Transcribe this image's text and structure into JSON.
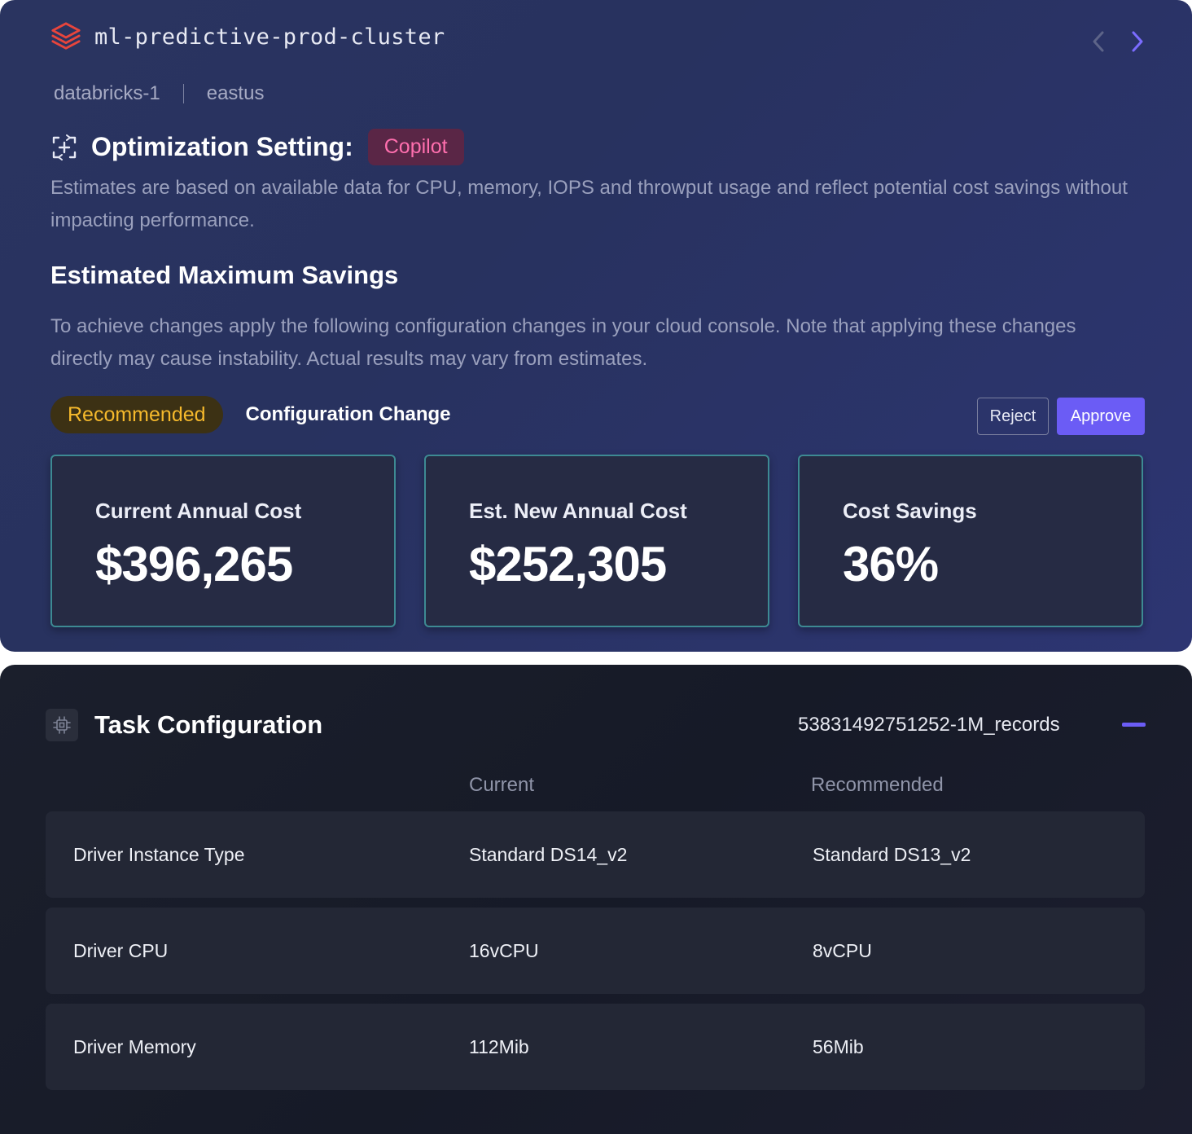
{
  "header": {
    "cluster_name": "ml-predictive-prod-cluster",
    "workspace": "databricks-1",
    "region": "eastus",
    "logo_icon": "databricks-stack-icon",
    "nav": {
      "prev_icon": "chevron-left-icon",
      "next_icon": "chevron-right-icon"
    }
  },
  "optimization": {
    "title": "Optimization Setting:",
    "badge": "Copilot",
    "icon": "optimize-icon",
    "description": "Estimates are based on available data for CPU, memory, IOPS and throwput usage and reflect potential cost savings without impacting performance."
  },
  "savings": {
    "title": "Estimated Maximum Savings",
    "description": "To achieve changes apply the following configuration changes in your cloud console. Note that applying these changes directly may cause instability. Actual results may vary from estimates."
  },
  "tabs": {
    "recommended": "Recommended",
    "configuration_change": "Configuration Change"
  },
  "actions": {
    "reject": "Reject",
    "approve": "Approve"
  },
  "cards": [
    {
      "label": "Current Annual Cost",
      "value": "$396,265"
    },
    {
      "label": "Est. New Annual Cost",
      "value": "$252,305"
    },
    {
      "label": "Cost Savings",
      "value": "36%"
    }
  ],
  "task": {
    "title": "Task Configuration",
    "icon": "cpu-chip-icon",
    "id": "53831492751252-1M_records",
    "collapse_icon": "minus-icon",
    "columns": [
      "Current",
      "Recommended"
    ],
    "rows": [
      {
        "label": "Driver Instance Type",
        "current": "Standard DS14_v2",
        "recommended": "Standard DS13_v2"
      },
      {
        "label": "Driver CPU",
        "current": "16vCPU",
        "recommended": "8vCPU"
      },
      {
        "label": "Driver Memory",
        "current": "112Mib",
        "recommended": "56Mib"
      }
    ]
  },
  "colors": {
    "accent": "#6b5cf5",
    "copilot_bg": "#5a2646",
    "copilot_text": "#ff6fae",
    "recommended_bg": "#3c3114",
    "recommended_text": "#f5b92c",
    "card_border": "#3d8a93",
    "logo_red": "#e8453c"
  }
}
